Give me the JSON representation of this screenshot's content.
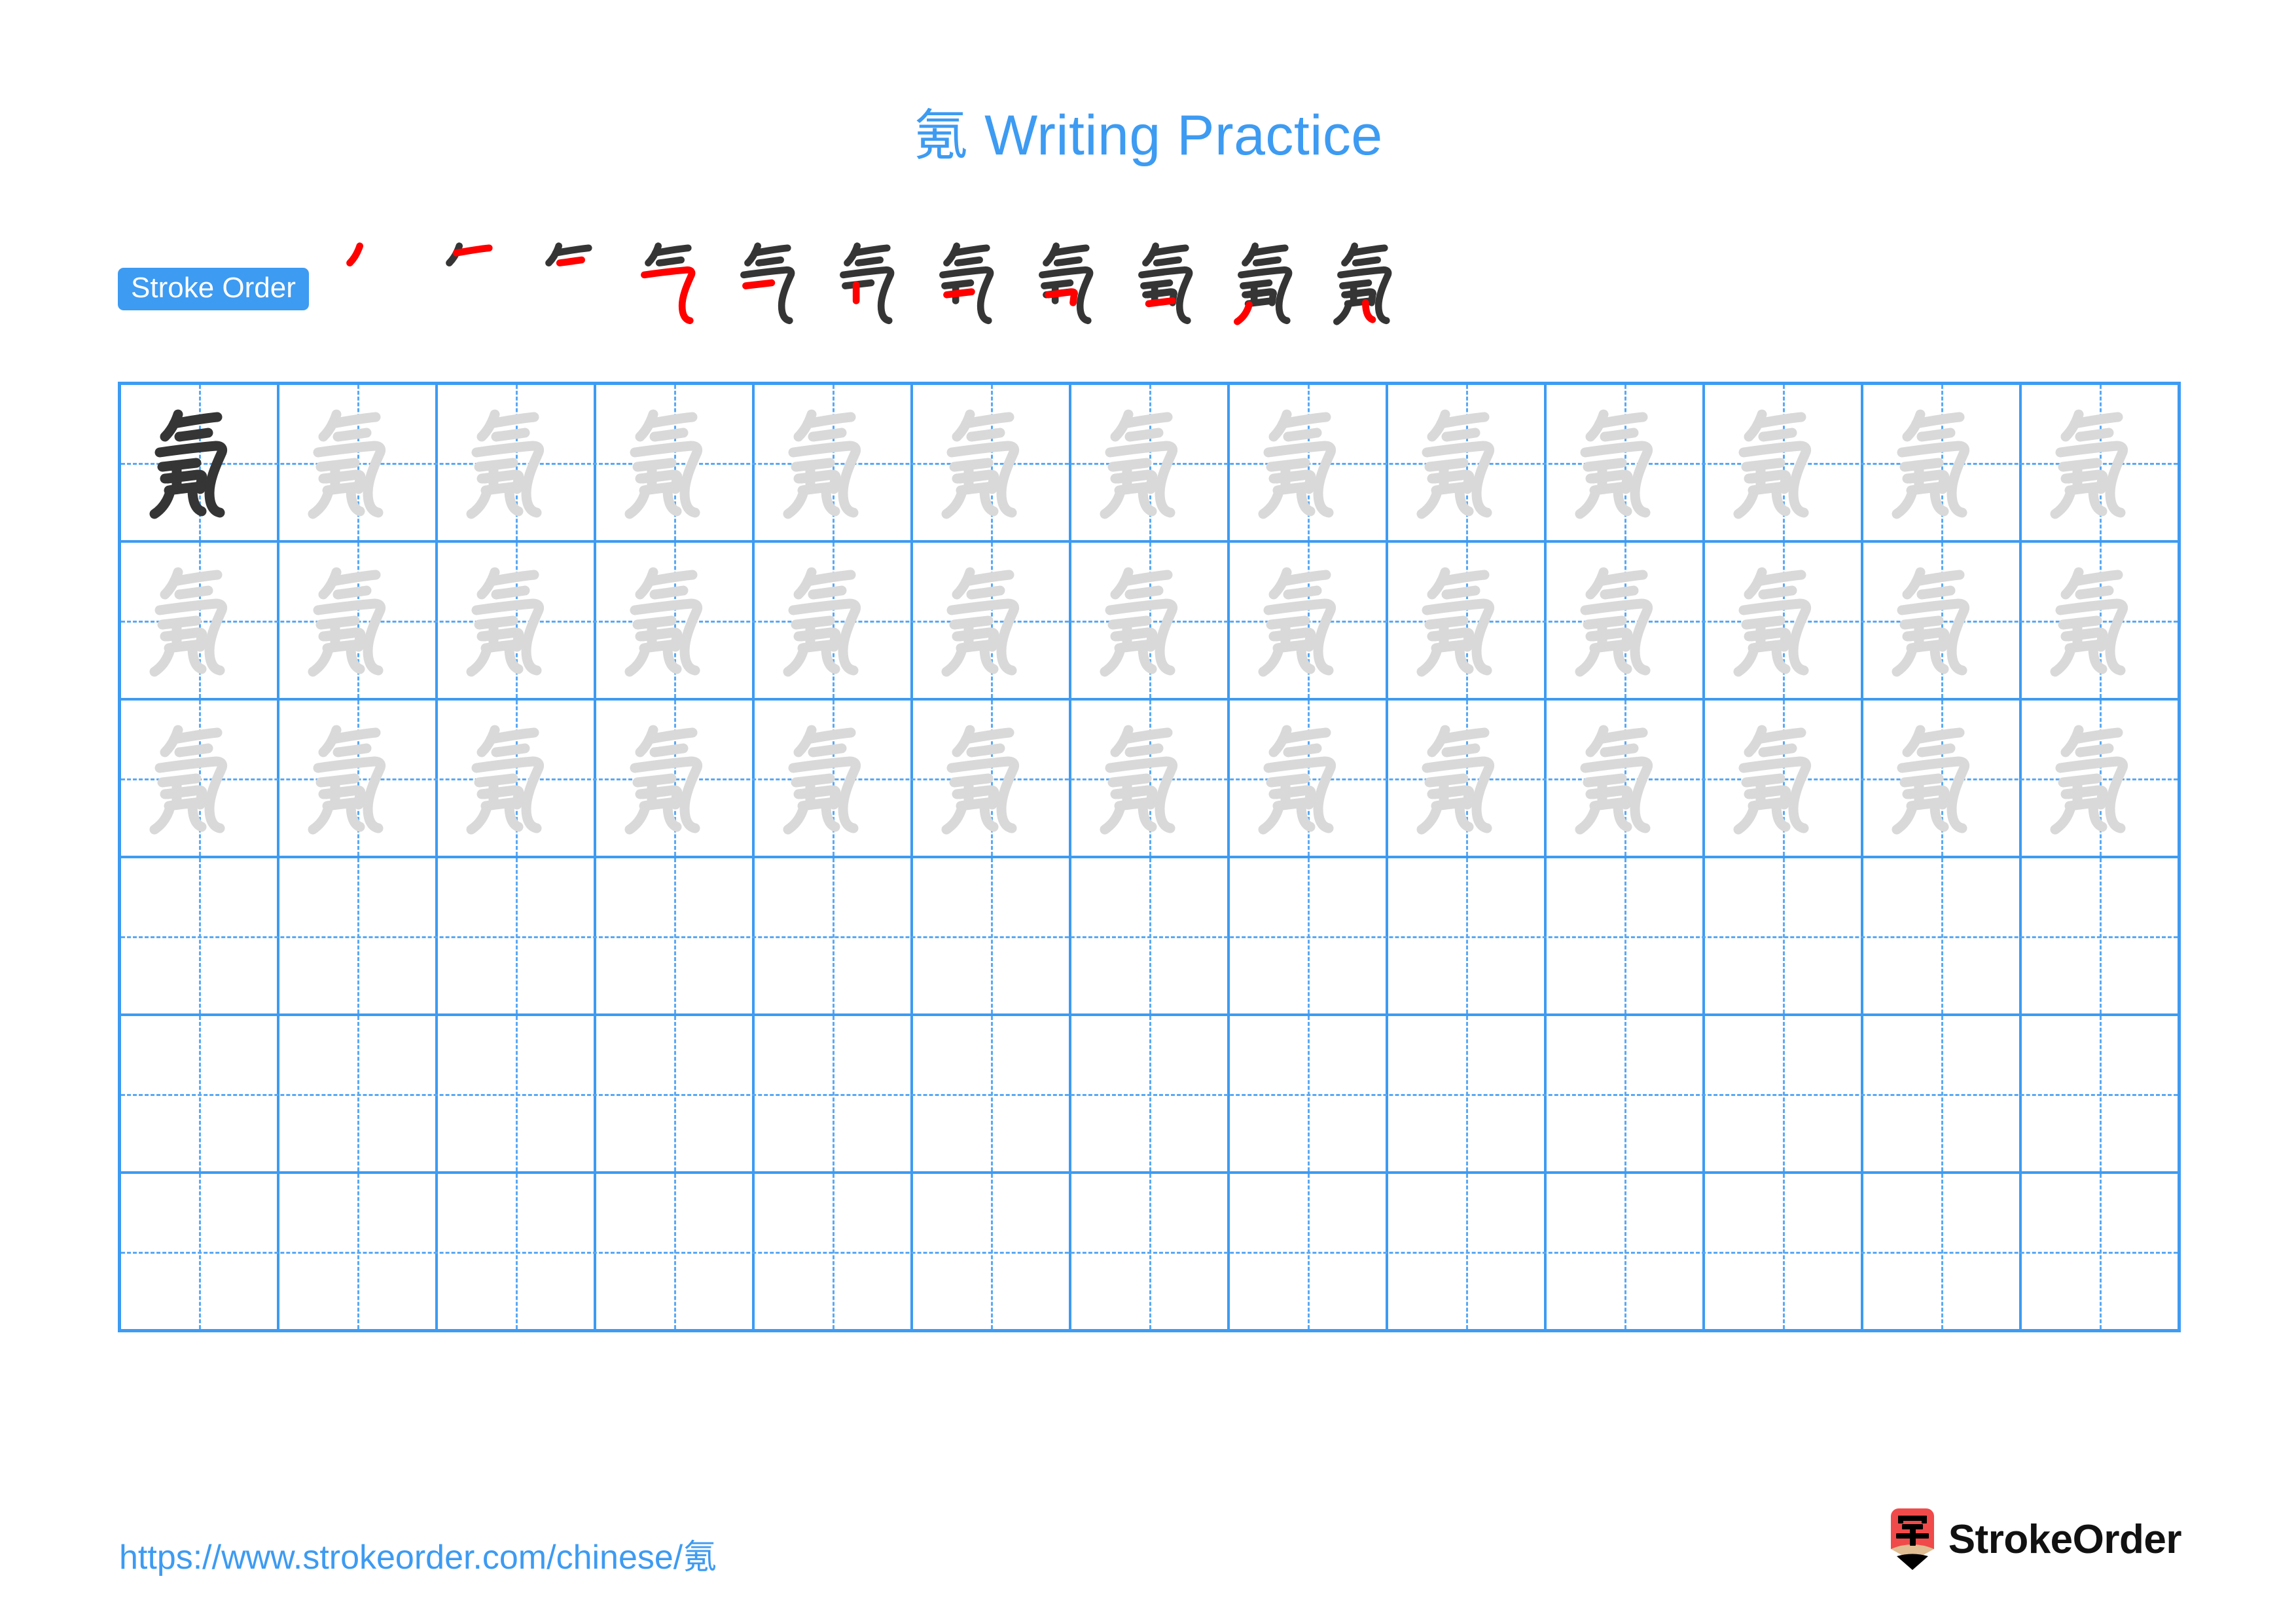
{
  "page": {
    "character": "氪",
    "title": "氪 Writing Practice",
    "title_suffix": "Writing Practice"
  },
  "colors": {
    "accent_blue": "#3d9bf2",
    "grid_line": "#3d9bf2",
    "grid_dash": "#59a9f5",
    "stroke_new": "#ff0000",
    "stroke_done": "#353535",
    "trace_gray": "#d9d9d9",
    "model_dark": "#353535",
    "logo_red": "#f04a4a",
    "logo_wood": "#e0bd92",
    "logo_tip": "#000000"
  },
  "stroke_order": {
    "badge_label": "Stroke Order",
    "total_steps": 11,
    "steps": [
      {
        "index": 1,
        "new_stroke_name": "pie",
        "strokes_drawn": 1
      },
      {
        "index": 2,
        "new_stroke_name": "heng",
        "strokes_drawn": 2
      },
      {
        "index": 3,
        "new_stroke_name": "heng",
        "strokes_drawn": 3
      },
      {
        "index": 4,
        "new_stroke_name": "heng-zhe-wan-gou",
        "strokes_drawn": 4
      },
      {
        "index": 5,
        "new_stroke_name": "heng",
        "strokes_drawn": 5
      },
      {
        "index": 6,
        "new_stroke_name": "shu",
        "strokes_drawn": 6
      },
      {
        "index": 7,
        "new_stroke_name": "heng",
        "strokes_drawn": 7
      },
      {
        "index": 8,
        "new_stroke_name": "heng-zhe",
        "strokes_drawn": 8
      },
      {
        "index": 9,
        "new_stroke_name": "heng",
        "strokes_drawn": 9
      },
      {
        "index": 10,
        "new_stroke_name": "pie",
        "strokes_drawn": 10
      },
      {
        "index": 11,
        "new_stroke_name": "shu-wan-gou",
        "strokes_drawn": 11
      }
    ]
  },
  "practice_grid": {
    "columns": 13,
    "rows": 6,
    "cells": [
      [
        "model",
        "trace",
        "trace",
        "trace",
        "trace",
        "trace",
        "trace",
        "trace",
        "trace",
        "trace",
        "trace",
        "trace",
        "trace"
      ],
      [
        "trace",
        "trace",
        "trace",
        "trace",
        "trace",
        "trace",
        "trace",
        "trace",
        "trace",
        "trace",
        "trace",
        "trace",
        "trace"
      ],
      [
        "trace",
        "trace",
        "trace",
        "trace",
        "trace",
        "trace",
        "trace",
        "trace",
        "trace",
        "trace",
        "trace",
        "trace",
        "trace"
      ],
      [
        "empty",
        "empty",
        "empty",
        "empty",
        "empty",
        "empty",
        "empty",
        "empty",
        "empty",
        "empty",
        "empty",
        "empty",
        "empty"
      ],
      [
        "empty",
        "empty",
        "empty",
        "empty",
        "empty",
        "empty",
        "empty",
        "empty",
        "empty",
        "empty",
        "empty",
        "empty",
        "empty"
      ],
      [
        "empty",
        "empty",
        "empty",
        "empty",
        "empty",
        "empty",
        "empty",
        "empty",
        "empty",
        "empty",
        "empty",
        "empty",
        "empty"
      ]
    ]
  },
  "footer": {
    "url": "https://www.strokeorder.com/chinese/氪",
    "brand_name": "StrokeOrder",
    "brand_mark_character": "字"
  }
}
